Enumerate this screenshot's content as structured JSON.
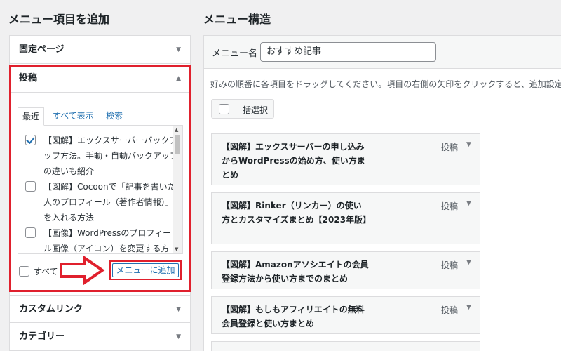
{
  "left": {
    "title": "メニュー項目を追加",
    "sections": {
      "fixed_page": "固定ページ",
      "posts": "投稿",
      "custom_link": "カスタムリンク",
      "category": "カテゴリー"
    },
    "tabs": {
      "recent": "最近",
      "view_all": "すべて表示",
      "search": "検索"
    },
    "items": [
      {
        "text": "【図解】エックスサーバーバックアップ方法。手動・自動バックアップの違いも紹介",
        "checked": true
      },
      {
        "text": "【図解】Cocoonで「記事を書いた人のプロフィール（著作者情報）」を入れる方法",
        "checked": false
      },
      {
        "text": "【画像】WordPressのプロフィール画像（アイコン）を変更する方",
        "checked": false
      }
    ],
    "select_all": "すべて",
    "add_button": "メニューに追加"
  },
  "right": {
    "title": "メニュー構造",
    "menu_name_label": "メニュー名",
    "menu_name_value": "おすすめ記事",
    "instructions": "好みの順番に各項目をドラッグしてください。項目の右側の矢印をクリックすると、追加設定",
    "bulk_select": "一括選択",
    "items": [
      {
        "title": "【図解】エックスサーバーの申し込みからWordPressの始め方、使い方まとめ",
        "type": "投稿"
      },
      {
        "title": "【図解】Rinker（リンカー）の使い方とカスタマイズまとめ【2023年版】",
        "type": "投稿"
      },
      {
        "title": "【図解】Amazonアソシエイトの会員登録方法から使い方までのまとめ",
        "type": "投稿"
      },
      {
        "title": "【図解】もしもアフィリエイトの無料会員登録と使い方まとめ",
        "type": "投稿"
      }
    ]
  },
  "colors": {
    "highlight_red": "#e0202d",
    "link_blue": "#2271b1"
  }
}
